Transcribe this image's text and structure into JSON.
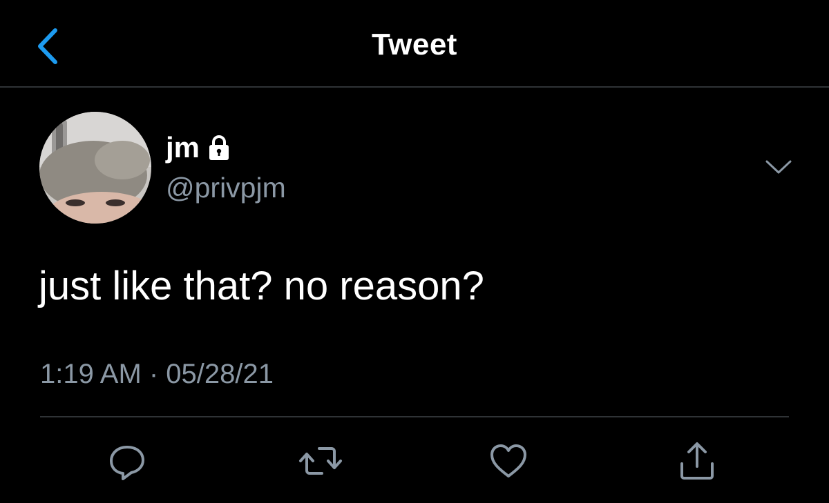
{
  "header": {
    "title": "Tweet",
    "back_icon": "chevron-left-icon"
  },
  "author": {
    "display_name": "jm",
    "handle": "@privpjm",
    "protected_icon": "lock-icon"
  },
  "tweet": {
    "text": "just like that? no reason?",
    "timestamp": "1:19 AM · 05/28/21"
  },
  "actions": [
    {
      "name": "reply",
      "icon": "reply-icon"
    },
    {
      "name": "retweet",
      "icon": "retweet-icon"
    },
    {
      "name": "like",
      "icon": "heart-icon"
    },
    {
      "name": "share",
      "icon": "share-icon"
    }
  ],
  "colors": {
    "background": "#000000",
    "accent": "#1d9bf0",
    "secondary_text": "#8b98a5",
    "divider": "#2f3336"
  }
}
